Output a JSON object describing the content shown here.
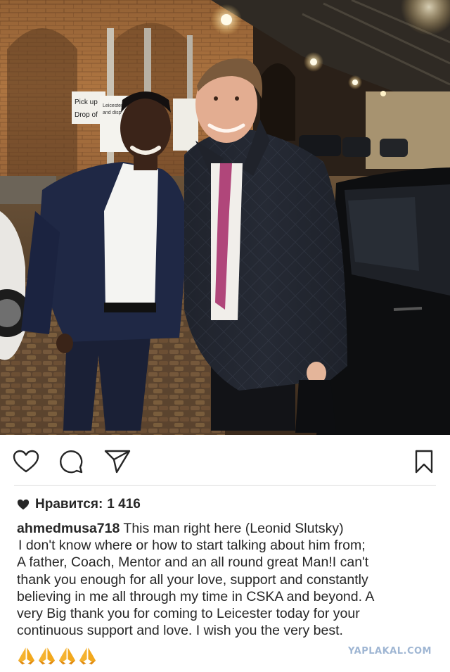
{
  "post": {
    "photo_description_icon": "post-photo",
    "likes_label": "Нравится:",
    "likes_count": "1 416",
    "username": "ahmedmusa718",
    "caption_first": "This man right here (Leonid Slutsky)",
    "caption_lines": [
      "I don't know where or how to start talking about him from;",
      "A father, Coach, Mentor and an all round great Man!I can't",
      "thank you enough for all your love, support and constantly",
      "believing in me all through my time in CSKA and beyond. A",
      "very Big thank you for coming to Leicester today for your",
      "continuous support and love. I wish you the very best."
    ],
    "emojis": [
      "pray-icon",
      "pray-icon",
      "pray-icon",
      "pray-icon"
    ]
  },
  "photo_signs": {
    "sign_left_1": "Pick up",
    "sign_left_2": "Drop of",
    "sign_mid_1": "Leicester st",
    "sign_mid_2": "and disp"
  },
  "actions": {
    "like": "heart-outline-icon",
    "comment": "comment-bubble-icon",
    "share": "send-paper-plane-icon",
    "save": "bookmark-icon"
  },
  "watermark": "YAPLAKAL.COM",
  "colors": {
    "text": "#262626",
    "divider": "#dbdbdb",
    "watermark": "#9fb6d3"
  }
}
